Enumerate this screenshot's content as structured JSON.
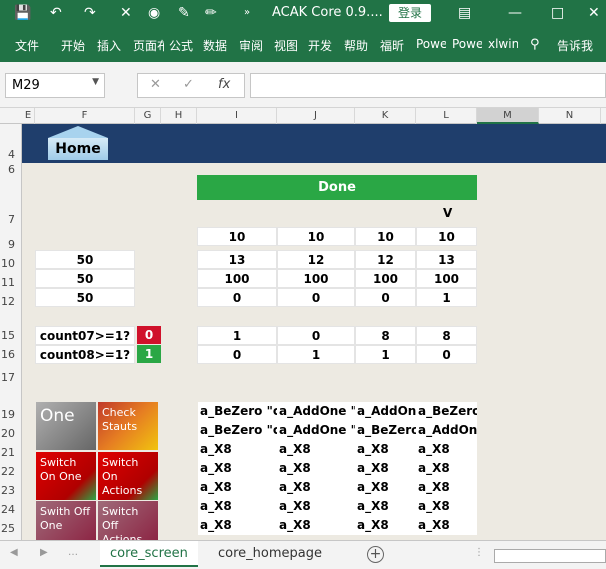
{
  "titlebar": {
    "title": "ACAK Core 0.9....",
    "login": "登录"
  },
  "ribbon": {
    "tabs": [
      "文件",
      "开始",
      "插入",
      "页面布",
      "公式",
      "数据",
      "审阅",
      "视图",
      "开发",
      "帮助",
      "福昕",
      "Powe",
      "Powe",
      "xlwin",
      "告诉我"
    ]
  },
  "formula": {
    "namebox": "M29",
    "cancel": "✕",
    "confirm": "✓",
    "fx": "fx",
    "value": ""
  },
  "columns": [
    "E",
    "F",
    "G",
    "H",
    "I",
    "J",
    "K",
    "L",
    "M",
    "N"
  ],
  "rows": [
    "4",
    "6",
    "7",
    "9",
    "10",
    "11",
    "12",
    "15",
    "16",
    "17",
    "19",
    "20",
    "21",
    "22",
    "23",
    "24",
    "25"
  ],
  "home": {
    "label": "Home"
  },
  "status": {
    "done": "Done",
    "v_label": "V"
  },
  "values": {
    "row9": [
      "10",
      "10",
      "10",
      "10"
    ],
    "row10": [
      "13",
      "12",
      "12",
      "13"
    ],
    "row11": [
      "100",
      "100",
      "100",
      "100"
    ],
    "row12": [
      "0",
      "0",
      "0",
      "1"
    ],
    "left": [
      "50",
      "50",
      "50"
    ]
  },
  "counts": [
    {
      "label": "count07>=1?",
      "flag": "0",
      "color": "#d0112b",
      "vals": [
        "1",
        "0",
        "8",
        "8"
      ]
    },
    {
      "label": "count08>=1?",
      "flag": "1",
      "color": "#2aa745",
      "vals": [
        "0",
        "1",
        "1",
        "0"
      ]
    }
  ],
  "tiles": [
    {
      "label": "One",
      "color": "#888888"
    },
    {
      "label": "Check Stauts",
      "color": "#d9711b"
    },
    {
      "label": "Switch On One",
      "color": "#c00000"
    },
    {
      "label": "Switch On Actions",
      "color": "#c00000"
    },
    {
      "label": "Swith Off One",
      "color": "#8b1f3f"
    },
    {
      "label": "Switch Off Actions",
      "color": "#8b1f3f"
    }
  ],
  "table": [
    [
      "a_BeZero \"cc",
      "a_AddOne \"c",
      "a_AddOne",
      "a_BeZero"
    ],
    [
      "a_BeZero \"cc",
      "a_AddOne \"c",
      "a_BeZero",
      "a_AddOne"
    ],
    [
      "a_X8",
      "a_X8",
      "a_X8",
      "a_X8"
    ],
    [
      "a_X8",
      "a_X8",
      "a_X8",
      "a_X8"
    ],
    [
      "a_X8",
      "a_X8",
      "a_X8",
      "a_X8"
    ],
    [
      "a_X8",
      "a_X8",
      "a_X8",
      "a_X8"
    ],
    [
      "a_X8",
      "a_X8",
      "a_X8",
      "a_X8"
    ]
  ],
  "sheets": {
    "active": "core_screen",
    "other": "core_homepage",
    "add": "+"
  }
}
